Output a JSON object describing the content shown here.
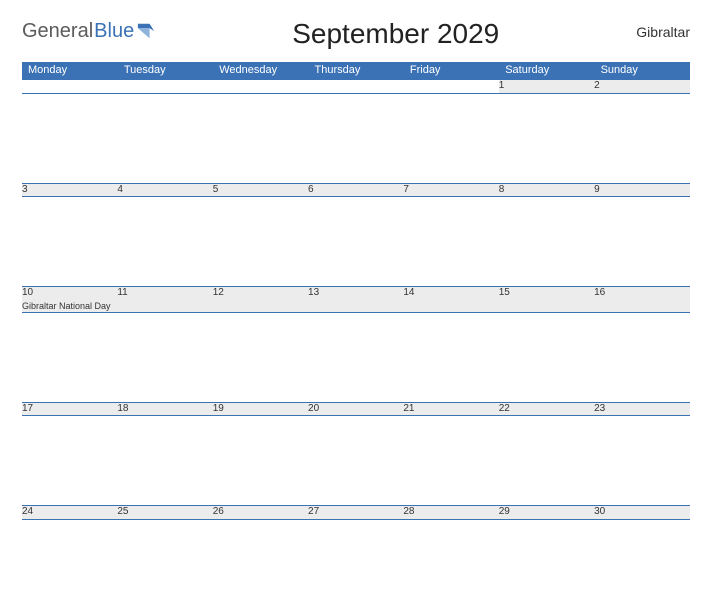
{
  "logo": {
    "general": "General",
    "blue": "Blue"
  },
  "title": "September 2029",
  "region": "Gibraltar",
  "weekdays": [
    "Monday",
    "Tuesday",
    "Wednesday",
    "Thursday",
    "Friday",
    "Saturday",
    "Sunday"
  ],
  "weeks": [
    {
      "days": [
        {
          "num": "",
          "holiday": ""
        },
        {
          "num": "",
          "holiday": ""
        },
        {
          "num": "",
          "holiday": ""
        },
        {
          "num": "",
          "holiday": ""
        },
        {
          "num": "",
          "holiday": ""
        },
        {
          "num": "1",
          "holiday": ""
        },
        {
          "num": "2",
          "holiday": ""
        }
      ]
    },
    {
      "days": [
        {
          "num": "3",
          "holiday": ""
        },
        {
          "num": "4",
          "holiday": ""
        },
        {
          "num": "5",
          "holiday": ""
        },
        {
          "num": "6",
          "holiday": ""
        },
        {
          "num": "7",
          "holiday": ""
        },
        {
          "num": "8",
          "holiday": ""
        },
        {
          "num": "9",
          "holiday": ""
        }
      ]
    },
    {
      "days": [
        {
          "num": "10",
          "holiday": "Gibraltar National Day"
        },
        {
          "num": "11",
          "holiday": ""
        },
        {
          "num": "12",
          "holiday": ""
        },
        {
          "num": "13",
          "holiday": ""
        },
        {
          "num": "14",
          "holiday": ""
        },
        {
          "num": "15",
          "holiday": ""
        },
        {
          "num": "16",
          "holiday": ""
        }
      ]
    },
    {
      "days": [
        {
          "num": "17",
          "holiday": ""
        },
        {
          "num": "18",
          "holiday": ""
        },
        {
          "num": "19",
          "holiday": ""
        },
        {
          "num": "20",
          "holiday": ""
        },
        {
          "num": "21",
          "holiday": ""
        },
        {
          "num": "22",
          "holiday": ""
        },
        {
          "num": "23",
          "holiday": ""
        }
      ]
    },
    {
      "days": [
        {
          "num": "24",
          "holiday": ""
        },
        {
          "num": "25",
          "holiday": ""
        },
        {
          "num": "26",
          "holiday": ""
        },
        {
          "num": "27",
          "holiday": ""
        },
        {
          "num": "28",
          "holiday": ""
        },
        {
          "num": "29",
          "holiday": ""
        },
        {
          "num": "30",
          "holiday": ""
        }
      ]
    }
  ],
  "colors": {
    "accent": "#3a72b5",
    "day_bg": "#ececec"
  }
}
